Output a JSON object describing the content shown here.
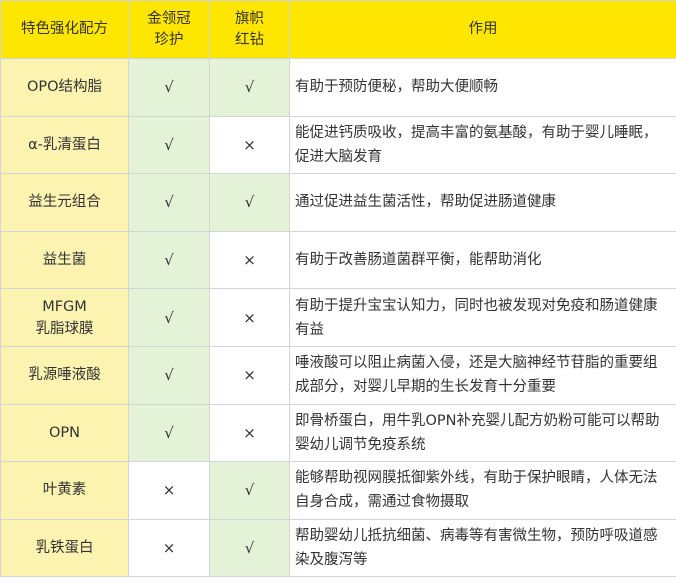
{
  "headers": {
    "feature": "特色强化配方",
    "product_a": "金领冠\n珍护",
    "product_b": "旗帜\n红钻",
    "effect": "作用"
  },
  "symbols": {
    "check": "√",
    "cross": "×"
  },
  "colors": {
    "header_bg": "#ffe600",
    "feature_col_bg": "#fdf3b0",
    "check_cell_bg": "#e4f2d7"
  },
  "rows": [
    {
      "feature": "OPO结构脂",
      "a": "√",
      "b": "√",
      "effect": "有助于预防便秘，帮助大便顺畅"
    },
    {
      "feature": "α-乳清蛋白",
      "a": "√",
      "b": "×",
      "effect": "能促进钙质吸收，提高丰富的氨基酸，有助于婴儿睡眠，促进大脑发育"
    },
    {
      "feature": "益生元组合",
      "a": "√",
      "b": "√",
      "effect": "通过促进益生菌活性，帮助促进肠道健康"
    },
    {
      "feature": "益生菌",
      "a": "√",
      "b": "×",
      "effect": "有助于改善肠道菌群平衡，能帮助消化"
    },
    {
      "feature": "MFGM\n乳脂球膜",
      "a": "√",
      "b": "×",
      "effect": "有助于提升宝宝认知力，同时也被发现对免疫和肠道健康有益"
    },
    {
      "feature": "乳源唾液酸",
      "a": "√",
      "b": "×",
      "effect": "唾液酸可以阻止病菌入侵，还是大脑神经节苷脂的重要组成部分，对婴儿早期的生长发育十分重要"
    },
    {
      "feature": "OPN",
      "a": "√",
      "b": "×",
      "effect": "即骨桥蛋白，用牛乳OPN补充婴儿配方奶粉可能可以帮助婴幼儿调节免疫系统"
    },
    {
      "feature": "叶黄素",
      "a": "×",
      "b": "√",
      "effect": "能够帮助视网膜抵御紫外线，有助于保护眼睛，人体无法自身合成，需通过食物摄取"
    },
    {
      "feature": "乳铁蛋白",
      "a": "×",
      "b": "√",
      "effect": "帮助婴幼儿抵抗细菌、病毒等有害微生物，预防呼吸道感染及腹泻等"
    }
  ]
}
